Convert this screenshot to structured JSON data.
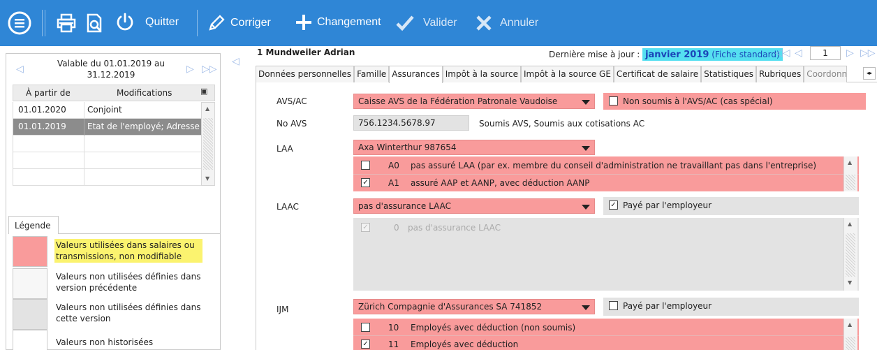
{
  "toolbar": {
    "quit_label": "Quitter",
    "correct_label": "Corriger",
    "change_label": "Changement",
    "validate_label": "Valider",
    "cancel_label": "Annuler"
  },
  "left": {
    "validity": "Valable du 01.01.2019 au 31.12.2019",
    "history_headers": [
      "À partir de",
      "Modifications"
    ],
    "history_rows": [
      {
        "date": "01.01.2020",
        "change": "Conjoint"
      },
      {
        "date": "01.01.2019",
        "change": "Etat de l'employé; Adresse"
      }
    ],
    "legend_tab": "Légende",
    "legend": [
      {
        "color": "#f99b9b",
        "text": "Valeurs utilisées dans salaires ou transmissions, non modifiable"
      },
      {
        "color": "#f7f7f7",
        "text": "Valeurs non utilisées définies dans version précédente"
      },
      {
        "color": "#e3e3e3",
        "text": "Valeurs non utilisées définies dans cette version"
      },
      {
        "color": "#ffffff",
        "text": "Valeurs non historisées"
      }
    ]
  },
  "header": {
    "employee": "1 Mundweiler Adrian",
    "last_update_label": "Dernière mise à jour :",
    "last_update_month": "janvier 2019",
    "last_update_std": "(Fiche standard)",
    "page": "1"
  },
  "tabs": [
    "Données personnelles",
    "Famille",
    "Assurances",
    "Impôt à la source",
    "Impôt à la source GE",
    "Certificat de salaire",
    "Statistiques",
    "Rubriques",
    "Coordonné"
  ],
  "active_tab": "Assurances",
  "form": {
    "avs_label": "AVS/AC",
    "avs_value": "Caisse AVS de la Fédération Patronale Vaudoise",
    "avs_special": "Non soumis à l'AVS/AC (cas spécial)",
    "noavs_label": "No AVS",
    "noavs_value": "756.1234.5678.97",
    "noavs_status": "Soumis AVS, Soumis aux cotisations AC",
    "laa_label": "LAA",
    "laa_value": "Axa Winterthur 987654",
    "laa_rows": [
      {
        "code": "A0",
        "text": "pas assuré LAA (par ex. membre du conseil d'administration ne travaillant pas dans l'entreprise)",
        "checked": false
      },
      {
        "code": "A1",
        "text": "assuré AAP et AANP, avec déduction AANP",
        "checked": true
      }
    ],
    "laac_label": "LAAC",
    "laac_value": "pas d'assurance LAAC",
    "laac_employer": "Payé par l'employeur",
    "laac_rows": [
      {
        "code": "0",
        "text": "pas d'assurance LAAC",
        "checked": true
      }
    ],
    "ijm_label": "IJM",
    "ijm_value": "Zürich Compagnie d'Assurances SA 741852",
    "ijm_employer": "Payé par l'employeur",
    "ijm_rows": [
      {
        "code": "10",
        "text": "Employés avec déduction (non soumis)",
        "checked": false
      },
      {
        "code": "11",
        "text": "Employés avec déduction",
        "checked": true
      }
    ]
  }
}
